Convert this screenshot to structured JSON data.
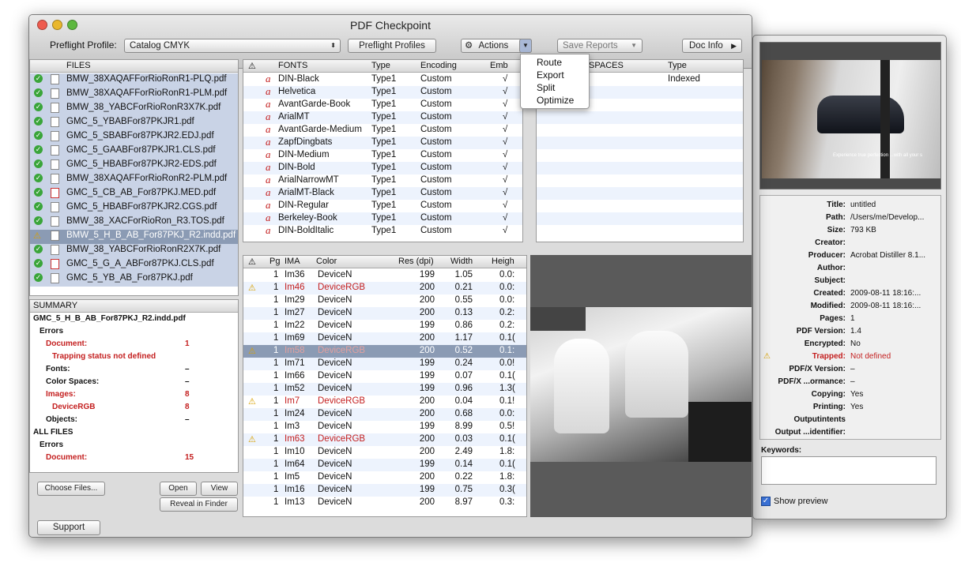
{
  "app": {
    "title": "PDF Checkpoint"
  },
  "toolbar": {
    "profile_label": "Preflight Profile:",
    "profile_value": "Catalog CMYK",
    "preflight_profiles": "Preflight Profiles",
    "actions": "Actions",
    "save_reports": "Save Reports",
    "doc_info": "Doc Info"
  },
  "actions_menu": [
    "Route",
    "Export",
    "Split",
    "Optimize"
  ],
  "files": {
    "header": "FILES",
    "items": [
      {
        "name": "BMW_38XAQAFForRioRonR1-PLQ.pdf",
        "status": "ok",
        "type": "doc"
      },
      {
        "name": "BMW_38XAQAFForRioRonR1-PLM.pdf",
        "status": "ok",
        "type": "doc"
      },
      {
        "name": "BMW_38_YABCForRioRonR3X7K.pdf",
        "status": "ok",
        "type": "doc"
      },
      {
        "name": "GMC_5_YBABFor87PKJR1.pdf",
        "status": "ok",
        "type": "doc"
      },
      {
        "name": "GMC_5_SBABFor87PKJR2.EDJ.pdf",
        "status": "ok",
        "type": "doc"
      },
      {
        "name": "GMC_5_GAABFor87PKJR1.CLS.pdf",
        "status": "ok",
        "type": "doc"
      },
      {
        "name": "GMC_5_HBABFor87PKJR2-EDS.pdf",
        "status": "ok",
        "type": "doc"
      },
      {
        "name": "BMW_38XAQAFForRioRonR2-PLM.pdf",
        "status": "ok",
        "type": "doc"
      },
      {
        "name": "GMC_5_CB_AB_For87PKJ.MED.pdf",
        "status": "ok",
        "type": "pdf"
      },
      {
        "name": "GMC_5_HBABFor87PKJR2.CGS.pdf",
        "status": "ok",
        "type": "doc"
      },
      {
        "name": "BMW_38_XACForRioRon_R3.TOS.pdf",
        "status": "ok",
        "type": "doc"
      },
      {
        "name": "BMW_5_H_B_AB_For87PKJ_R2.indd.pdf",
        "status": "warn",
        "type": "doc"
      },
      {
        "name": "BMW_38_YABCForRioRonR2X7K.pdf",
        "status": "ok",
        "type": "doc"
      },
      {
        "name": "GMC_5_G_A_ABFor87PKJ.CLS.pdf",
        "status": "ok",
        "type": "pdf"
      },
      {
        "name": "GMC_5_YB_AB_For87PKJ.pdf",
        "status": "ok",
        "type": "doc"
      }
    ]
  },
  "summary": {
    "header": "SUMMARY",
    "filename": "GMC_5_H_B_AB_For87PKJ_R2.indd.pdf",
    "lines": [
      {
        "label": "Errors",
        "value": "",
        "red": false,
        "indent": 1
      },
      {
        "label": "Document:",
        "value": "1",
        "red": true,
        "indent": 2
      },
      {
        "label": "Trapping status not defined",
        "value": "",
        "red": true,
        "indent": 3
      },
      {
        "label": "Fonts:",
        "value": "–",
        "red": false,
        "indent": 2
      },
      {
        "label": "Color Spaces:",
        "value": "–",
        "red": false,
        "indent": 2
      },
      {
        "label": "Images:",
        "value": "8",
        "red": true,
        "indent": 2
      },
      {
        "label": "DeviceRGB",
        "value": "8",
        "red": true,
        "indent": 3
      },
      {
        "label": "Objects:",
        "value": "–",
        "red": false,
        "indent": 2
      },
      {
        "label": "ALL FILES",
        "value": "",
        "red": false,
        "indent": 0
      },
      {
        "label": "Errors",
        "value": "",
        "red": false,
        "indent": 1
      },
      {
        "label": "Document:",
        "value": "15",
        "red": true,
        "indent": 2
      }
    ]
  },
  "buttons": {
    "choose_files": "Choose Files...",
    "open": "Open",
    "view": "View",
    "reveal": "Reveal in Finder",
    "support": "Support"
  },
  "fonts_table": {
    "headers": [
      "FONTS",
      "Type",
      "Encoding",
      "Emb"
    ],
    "rows": [
      [
        "DIN-Black",
        "Type1",
        "Custom",
        "√"
      ],
      [
        "Helvetica",
        "Type1",
        "Custom",
        "√"
      ],
      [
        "AvantGarde-Book",
        "Type1",
        "Custom",
        "√"
      ],
      [
        "ArialMT",
        "Type1",
        "Custom",
        "√"
      ],
      [
        "AvantGarde-Medium",
        "Type1",
        "Custom",
        "√"
      ],
      [
        "ZapfDingbats",
        "Type1",
        "Custom",
        "√"
      ],
      [
        "DIN-Medium",
        "Type1",
        "Custom",
        "√"
      ],
      [
        "DIN-Bold",
        "Type1",
        "Custom",
        "√"
      ],
      [
        "ArialNarrowMT",
        "Type1",
        "Custom",
        "√"
      ],
      [
        "ArialMT-Black",
        "Type1",
        "Custom",
        "√"
      ],
      [
        "DIN-Regular",
        "Type1",
        "Custom",
        "√"
      ],
      [
        "Berkeley-Book",
        "Type1",
        "Custom",
        "√"
      ],
      [
        "DIN-BoldItalic",
        "Type1",
        "Custom",
        "√"
      ]
    ]
  },
  "spaces_table": {
    "headers": [
      "SPACES",
      "Type"
    ],
    "rows": [
      [
        "d",
        "Indexed"
      ]
    ]
  },
  "images_table": {
    "headers": [
      "Pg",
      "IMA",
      "Color",
      "Res (dpi)",
      "Width",
      "Heigh"
    ],
    "rows": [
      {
        "pg": "1",
        "ima": "Im36",
        "color": "DeviceN",
        "res": "199",
        "width": "1.05",
        "height": "0.0:",
        "warn": false
      },
      {
        "pg": "1",
        "ima": "Im46",
        "color": "DeviceRGB",
        "res": "200",
        "width": "0.21",
        "height": "0.0:",
        "warn": true
      },
      {
        "pg": "1",
        "ima": "Im29",
        "color": "DeviceN",
        "res": "200",
        "width": "0.55",
        "height": "0.0:",
        "warn": false
      },
      {
        "pg": "1",
        "ima": "Im27",
        "color": "DeviceN",
        "res": "200",
        "width": "0.13",
        "height": "0.2:",
        "warn": false
      },
      {
        "pg": "1",
        "ima": "Im22",
        "color": "DeviceN",
        "res": "199",
        "width": "0.86",
        "height": "0.2:",
        "warn": false
      },
      {
        "pg": "1",
        "ima": "Im69",
        "color": "DeviceN",
        "res": "200",
        "width": "1.17",
        "height": "0.1(",
        "warn": false
      },
      {
        "pg": "1",
        "ima": "Im58",
        "color": "DeviceRGB",
        "res": "200",
        "width": "0.52",
        "height": "0.1:",
        "warn": true,
        "selected": true
      },
      {
        "pg": "1",
        "ima": "Im71",
        "color": "DeviceN",
        "res": "199",
        "width": "0.24",
        "height": "0.0!",
        "warn": false
      },
      {
        "pg": "1",
        "ima": "Im66",
        "color": "DeviceN",
        "res": "199",
        "width": "0.07",
        "height": "0.1(",
        "warn": false
      },
      {
        "pg": "1",
        "ima": "Im52",
        "color": "DeviceN",
        "res": "199",
        "width": "0.96",
        "height": "1.3(",
        "warn": false
      },
      {
        "pg": "1",
        "ima": "Im7",
        "color": "DeviceRGB",
        "res": "200",
        "width": "0.04",
        "height": "0.1!",
        "warn": true
      },
      {
        "pg": "1",
        "ima": "Im24",
        "color": "DeviceN",
        "res": "200",
        "width": "0.68",
        "height": "0.0:",
        "warn": false
      },
      {
        "pg": "1",
        "ima": "Im3",
        "color": "DeviceN",
        "res": "199",
        "width": "8.99",
        "height": "0.5!",
        "warn": false
      },
      {
        "pg": "1",
        "ima": "Im63",
        "color": "DeviceRGB",
        "res": "200",
        "width": "0.03",
        "height": "0.1(",
        "warn": true
      },
      {
        "pg": "1",
        "ima": "Im10",
        "color": "DeviceN",
        "res": "200",
        "width": "2.49",
        "height": "1.8:",
        "warn": false
      },
      {
        "pg": "1",
        "ima": "Im64",
        "color": "DeviceN",
        "res": "199",
        "width": "0.14",
        "height": "0.1(",
        "warn": false
      },
      {
        "pg": "1",
        "ima": "Im5",
        "color": "DeviceN",
        "res": "200",
        "width": "0.22",
        "height": "1.8:",
        "warn": false
      },
      {
        "pg": "1",
        "ima": "Im16",
        "color": "DeviceN",
        "res": "199",
        "width": "0.75",
        "height": "0.3(",
        "warn": false
      },
      {
        "pg": "1",
        "ima": "Im13",
        "color": "DeviceN",
        "res": "200",
        "width": "8.97",
        "height": "0.3:",
        "warn": false
      }
    ]
  },
  "preview": {
    "caption": "Experience true perfection ...with all your s"
  },
  "inspector": {
    "fields": [
      {
        "k": "Title:",
        "v": "untitled",
        "red": false,
        "warn": false
      },
      {
        "k": "Path:",
        "v": "/Users/me/Develop...",
        "red": false,
        "warn": false
      },
      {
        "k": "Size:",
        "v": "793 KB",
        "red": false,
        "warn": false
      },
      {
        "k": "Creator:",
        "v": "",
        "red": false,
        "warn": false
      },
      {
        "k": "Producer:",
        "v": "Acrobat Distiller 8.1...",
        "red": false,
        "warn": false
      },
      {
        "k": "Author:",
        "v": "",
        "red": false,
        "warn": false
      },
      {
        "k": "Subject:",
        "v": "",
        "red": false,
        "warn": false
      },
      {
        "k": "Created:",
        "v": "2009-08-11 18:16:...",
        "red": false,
        "warn": false
      },
      {
        "k": "Modified:",
        "v": "2009-08-11 18:16:...",
        "red": false,
        "warn": false
      },
      {
        "k": "Pages:",
        "v": "1",
        "red": false,
        "warn": false
      },
      {
        "k": "PDF Version:",
        "v": "1.4",
        "red": false,
        "warn": false
      },
      {
        "k": "Encrypted:",
        "v": "No",
        "red": false,
        "warn": false
      },
      {
        "k": "Trapped:",
        "v": "Not defined",
        "red": true,
        "warn": true
      },
      {
        "k": "PDF/X Version:",
        "v": "–",
        "red": false,
        "warn": false
      },
      {
        "k": "PDF/X ...ormance:",
        "v": "–",
        "red": false,
        "warn": false
      },
      {
        "k": "Copying:",
        "v": "Yes",
        "red": false,
        "warn": false
      },
      {
        "k": "Printing:",
        "v": "Yes",
        "red": false,
        "warn": false
      },
      {
        "k": "Outputintents",
        "v": "",
        "red": false,
        "warn": false
      },
      {
        "k": "Output ...identifier:",
        "v": "",
        "red": false,
        "warn": false
      }
    ],
    "keywords_label": "Keywords:",
    "show_preview": "Show preview"
  }
}
